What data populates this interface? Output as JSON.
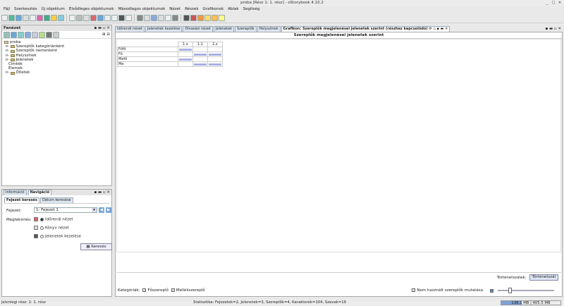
{
  "window": {
    "title": "proba [Rész 1: 1. rész] - oStorybook 4.10.2"
  },
  "menu": [
    "Fájl",
    "Szerkesztés",
    "Új objektum",
    "Elsődleges objektumok",
    "Másodlagos objektumok",
    "Nézet",
    "Részek",
    "Grafikonok",
    "Ablak",
    "Segítség"
  ],
  "tree_panel": {
    "title": "Fanézet",
    "root": "proba",
    "items": [
      "Szereplők kategóriánként",
      "Szereplők nemenként",
      "Helyszínek",
      "Jelenetek",
      "Címkék",
      "Elemek",
      "Ötletek"
    ]
  },
  "nav_panel": {
    "tabs": [
      "Információ",
      "Navigáció"
    ],
    "subtabs": [
      "Fejezet keresés",
      "Dátum keresése"
    ],
    "chapter_label": "Fejezet:",
    "chapter_value": "1: Fejezet 1",
    "view_label": "Megtekintés:",
    "views": [
      "Időrendi nézet",
      "Könyv nézet",
      "Jelenetek kezelése"
    ],
    "search_button": "Keresés"
  },
  "doc_tabs": [
    "Időrendi nézet",
    "Jelenetek kezelése",
    "Olvasási nézet",
    "Jelenetek",
    "Szereplők",
    "Helyszínek"
  ],
  "chart_tab": "Grafikon: Szereplők megjelenései jelenetek szerint (részhez kapcsolódó)",
  "chart_title": "Szereplők megjelenései jelenetek szerint",
  "chart_data": {
    "type": "table",
    "columns": [
      "1.x",
      "1.1",
      "2.x"
    ],
    "rows": [
      {
        "name": "Főfő",
        "cells": [
          1,
          0,
          0
        ]
      },
      {
        "name": "Fő",
        "cells": [
          0,
          1,
          1
        ]
      },
      {
        "name": "Mefő",
        "cells": [
          1,
          0,
          0
        ]
      },
      {
        "name": "Me",
        "cells": [
          0,
          1,
          1
        ]
      }
    ]
  },
  "history_label": "Történetszálak:",
  "history_button": "Történetszál",
  "categories_label": "Kategóriák:",
  "cat_main": "Főszereplő",
  "cat_side": "Mellékszereplő",
  "unused_label": "Nem használt szereplők mutatása",
  "status_left": "Jelenlegi rész: 1: 1. rész",
  "status_center": "Statisztika: Fejezetek=2, Jelenetek=3, Szereplők=4, Karakterek=104, Szavak=19",
  "memory": "138.1 MB | 405.5 MB"
}
